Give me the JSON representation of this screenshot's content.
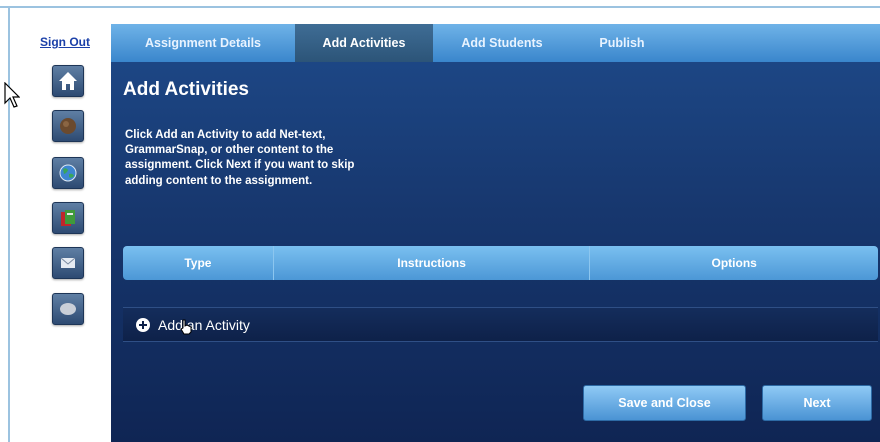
{
  "sidebar": {
    "sign_out": "Sign Out",
    "icons": [
      "home-icon",
      "nettext-icon",
      "globe-icon",
      "book-icon",
      "mail-icon",
      "chat-icon"
    ]
  },
  "tabs": [
    {
      "label": "Assignment Details",
      "active": false
    },
    {
      "label": "Add Activities",
      "active": true
    },
    {
      "label": "Add Students",
      "active": false
    },
    {
      "label": "Publish",
      "active": false
    }
  ],
  "main": {
    "title": "Add Activities",
    "description": "Click Add an Activity to add Net-text, GrammarSnap, or other content to the assignment. Click Next if you want to skip adding content to the assignment."
  },
  "table": {
    "columns": [
      "Type",
      "Instructions",
      "Options"
    ]
  },
  "add_activity": {
    "label": "Add an Activity",
    "icon": "plus-circle-icon"
  },
  "buttons": {
    "save_and_close": "Save and Close",
    "next": "Next"
  },
  "colors": {
    "panel": "#17376e",
    "tab_bar": "#4f9ad8",
    "active_tab": "#3a6a92",
    "button": "#6cb2ea",
    "sign_out_link": "#1a3fa8"
  }
}
